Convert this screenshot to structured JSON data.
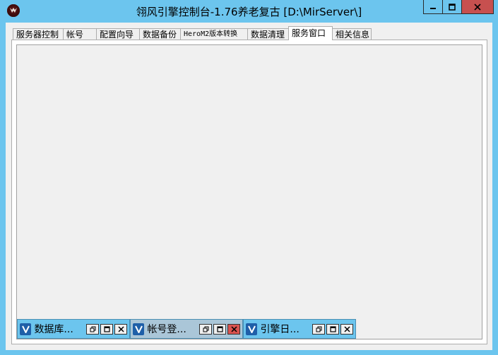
{
  "window": {
    "title": "翎风引擎控制台-1.76养老复古 [D:\\MirServer\\]"
  },
  "icons": {
    "app": "app-logo-icon",
    "minimize": "minimize-icon",
    "maximize": "maximize-icon",
    "close": "close-icon",
    "restore": "restore-icon",
    "child_app": "v-app-icon"
  },
  "colors": {
    "titlebar": "#6cc5ee",
    "close_button": "#c7504f",
    "active_child": "#aac6d8"
  },
  "tabs": [
    {
      "label": "服务器控制"
    },
    {
      "label": "帐号"
    },
    {
      "label": "配置向导"
    },
    {
      "label": "数据备份"
    },
    {
      "label": "HeroM2版本转换"
    },
    {
      "label": "数据清理"
    },
    {
      "label": "服务窗口",
      "active": true
    },
    {
      "label": "相关信息"
    }
  ],
  "minimized_windows": [
    {
      "title": "数据库..."
    },
    {
      "title": "帐号登...",
      "active": true
    },
    {
      "title": "引擎日..."
    }
  ]
}
